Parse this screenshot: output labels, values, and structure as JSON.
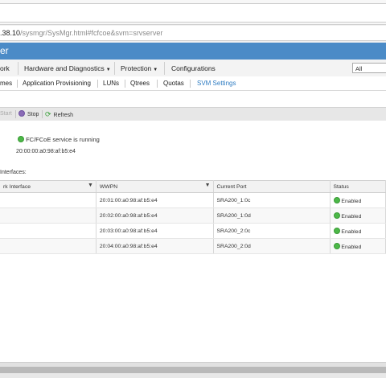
{
  "browser": {
    "url_host": ".38.10",
    "url_path": "/sysmgr/SysMgr.html#fcfcoe&svm=srvserver"
  },
  "header": {
    "title": "er"
  },
  "menu": {
    "items": [
      {
        "label": "ork",
        "has_caret": false
      },
      {
        "label": "Hardware and Diagnostics",
        "has_caret": true
      },
      {
        "label": "Protection",
        "has_caret": true
      },
      {
        "label": "Configurations",
        "has_caret": false
      }
    ],
    "scope_select": "All"
  },
  "tabs": {
    "items": [
      "mes",
      "Application Provisioning",
      "LUNs",
      "Qtrees",
      "Quotas",
      "SVM Settings"
    ],
    "active": "SVM Settings"
  },
  "toolbar": {
    "start_label": "Start",
    "stop_label": "Stop",
    "refresh_label": "Refresh"
  },
  "service": {
    "status_text": "FC/FCoE service is running",
    "wwnn": "20:00:00:a0:98:af:b5:e4"
  },
  "interfaces": {
    "label": "Interfaces:",
    "columns": [
      "rk Interface",
      "WWPN",
      "Current Port",
      "Status"
    ],
    "rows": [
      {
        "iface": "",
        "wwpn": "20:01:00:a0:98:af:b5:e4",
        "port": "SRA200_1:0c",
        "status": "Enabled"
      },
      {
        "iface": "",
        "wwpn": "20:02:00:a0:98:af:b5:e4",
        "port": "SRA200_1:0d",
        "status": "Enabled"
      },
      {
        "iface": "",
        "wwpn": "20:03:00:a0:98:af:b5:e4",
        "port": "SRA200_2:0c",
        "status": "Enabled"
      },
      {
        "iface": "",
        "wwpn": "20:04:00:a0:98:af:b5:e4",
        "port": "SRA200_2:0d",
        "status": "Enabled"
      }
    ]
  },
  "colors": {
    "header_blue": "#4b8bc7",
    "active_tab": "#2f7cc2",
    "status_green": "#4cb848"
  }
}
